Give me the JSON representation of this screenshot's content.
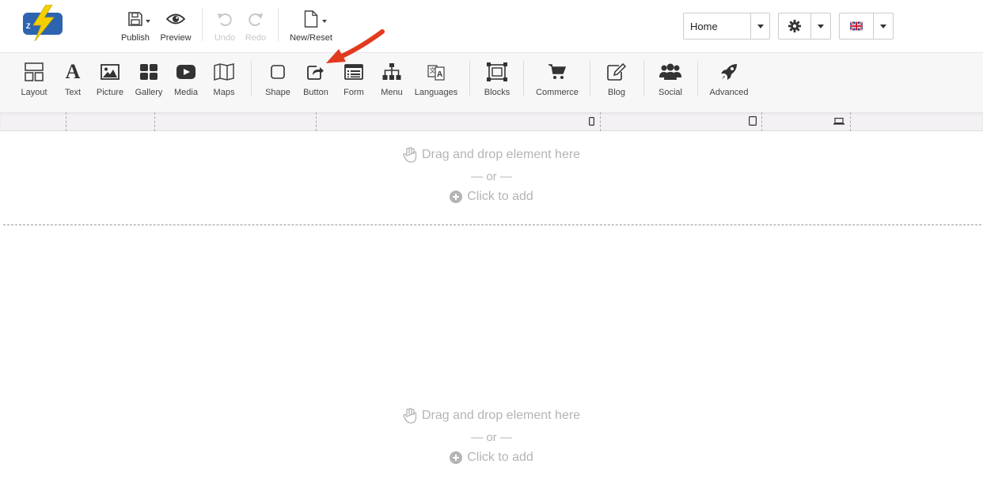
{
  "topbar": {
    "publish_label": "Publish",
    "preview_label": "Preview",
    "undo_label": "Undo",
    "redo_label": "Redo",
    "newreset_label": "New/Reset",
    "page_select_value": "Home",
    "language_flag": "uk-flag-icon"
  },
  "toolbar": {
    "items": [
      {
        "label": "Layout",
        "icon": "layout-icon"
      },
      {
        "label": "Text",
        "icon": "text-icon"
      },
      {
        "label": "Picture",
        "icon": "picture-icon"
      },
      {
        "label": "Gallery",
        "icon": "gallery-icon"
      },
      {
        "label": "Media",
        "icon": "media-icon"
      },
      {
        "label": "Maps",
        "icon": "map-icon"
      },
      {
        "label": "Shape",
        "icon": "shape-icon"
      },
      {
        "label": "Button",
        "icon": "button-icon"
      },
      {
        "label": "Form",
        "icon": "form-icon"
      },
      {
        "label": "Menu",
        "icon": "menu-icon"
      },
      {
        "label": "Languages",
        "icon": "languages-icon"
      },
      {
        "label": "Blocks",
        "icon": "blocks-icon"
      },
      {
        "label": "Commerce",
        "icon": "cart-icon"
      },
      {
        "label": "Blog",
        "icon": "blog-icon"
      },
      {
        "label": "Social",
        "icon": "social-icon"
      },
      {
        "label": "Advanced",
        "icon": "rocket-icon"
      }
    ]
  },
  "dropzones": [
    {
      "drag_text": "Drag and drop element here",
      "or_text": "— or —",
      "add_text": "Click to add"
    },
    {
      "drag_text": "Drag and drop element here",
      "or_text": "— or —",
      "add_text": "Click to add"
    }
  ],
  "colors": {
    "toolbar_bg": "#f7f7f7",
    "logo_blue": "#2d64b0",
    "logo_yellow": "#f5d000",
    "arrow_red": "#e23a1e",
    "placeholder_text": "#b4b4b4"
  }
}
